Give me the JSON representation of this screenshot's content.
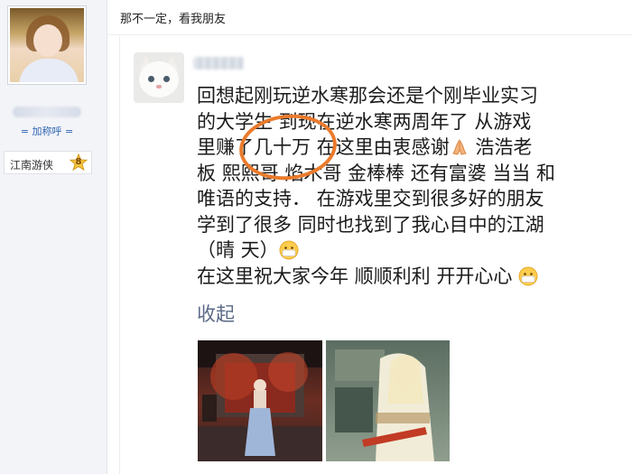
{
  "poster": {
    "nickname_link": "= 加称呼 =",
    "rank_label": "江南游侠",
    "rank_level": "8",
    "colors": {
      "link": "#2d64b3",
      "badge": "#f5c542"
    }
  },
  "post": {
    "text": "那不一定，看我朋友"
  },
  "quoted": {
    "lines": [
      "回想起刚玩逆水寒那会还是个刚毕业实习",
      "的大学生  到现在逆水寒两周年了 从游戏",
      "里赚了几十万 在这里由衷感谢",
      "板 熙熙哥 焰木哥 金棒棒 还有富婆 当当 和",
      "唯语的支持． 在游戏里交到很多好的朋友",
      "学到了很多 同时也找到了我心目中的江湖",
      "（晴 天）",
      "在这里祝大家今年 顺顺利利 开开心心"
    ],
    "line3_tail": "浩浩老",
    "collapse_label": "收起",
    "highlight_color": "#ea7b2d",
    "icons": [
      "pray-icon",
      "mask-face-icon",
      "mask-face-icon"
    ]
  }
}
